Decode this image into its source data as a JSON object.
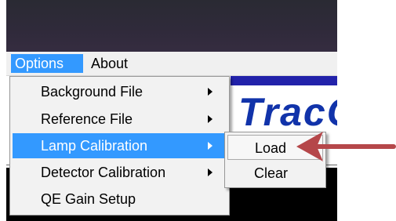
{
  "menubar": {
    "items": [
      {
        "label": "Options",
        "active": true
      },
      {
        "label": "About",
        "active": false
      }
    ]
  },
  "logo": {
    "text": "TracQ"
  },
  "options_menu": {
    "items": [
      {
        "label": "Background File",
        "has_submenu": true
      },
      {
        "label": "Reference File",
        "has_submenu": true
      },
      {
        "label": "Lamp Calibration",
        "has_submenu": true,
        "highlighted": true
      },
      {
        "label": "Detector Calibration",
        "has_submenu": true
      },
      {
        "label": "QE Gain Setup",
        "has_submenu": false
      }
    ]
  },
  "lamp_calibration_submenu": {
    "items": [
      {
        "label": "Load",
        "selected": true
      },
      {
        "label": "Clear",
        "selected": false
      }
    ]
  },
  "colors": {
    "highlight": "#3399ff",
    "annotation_arrow": "#b5474a"
  },
  "icons": {
    "submenu_indicator": "chevron-right-icon",
    "callout": "arrow-left-icon"
  }
}
